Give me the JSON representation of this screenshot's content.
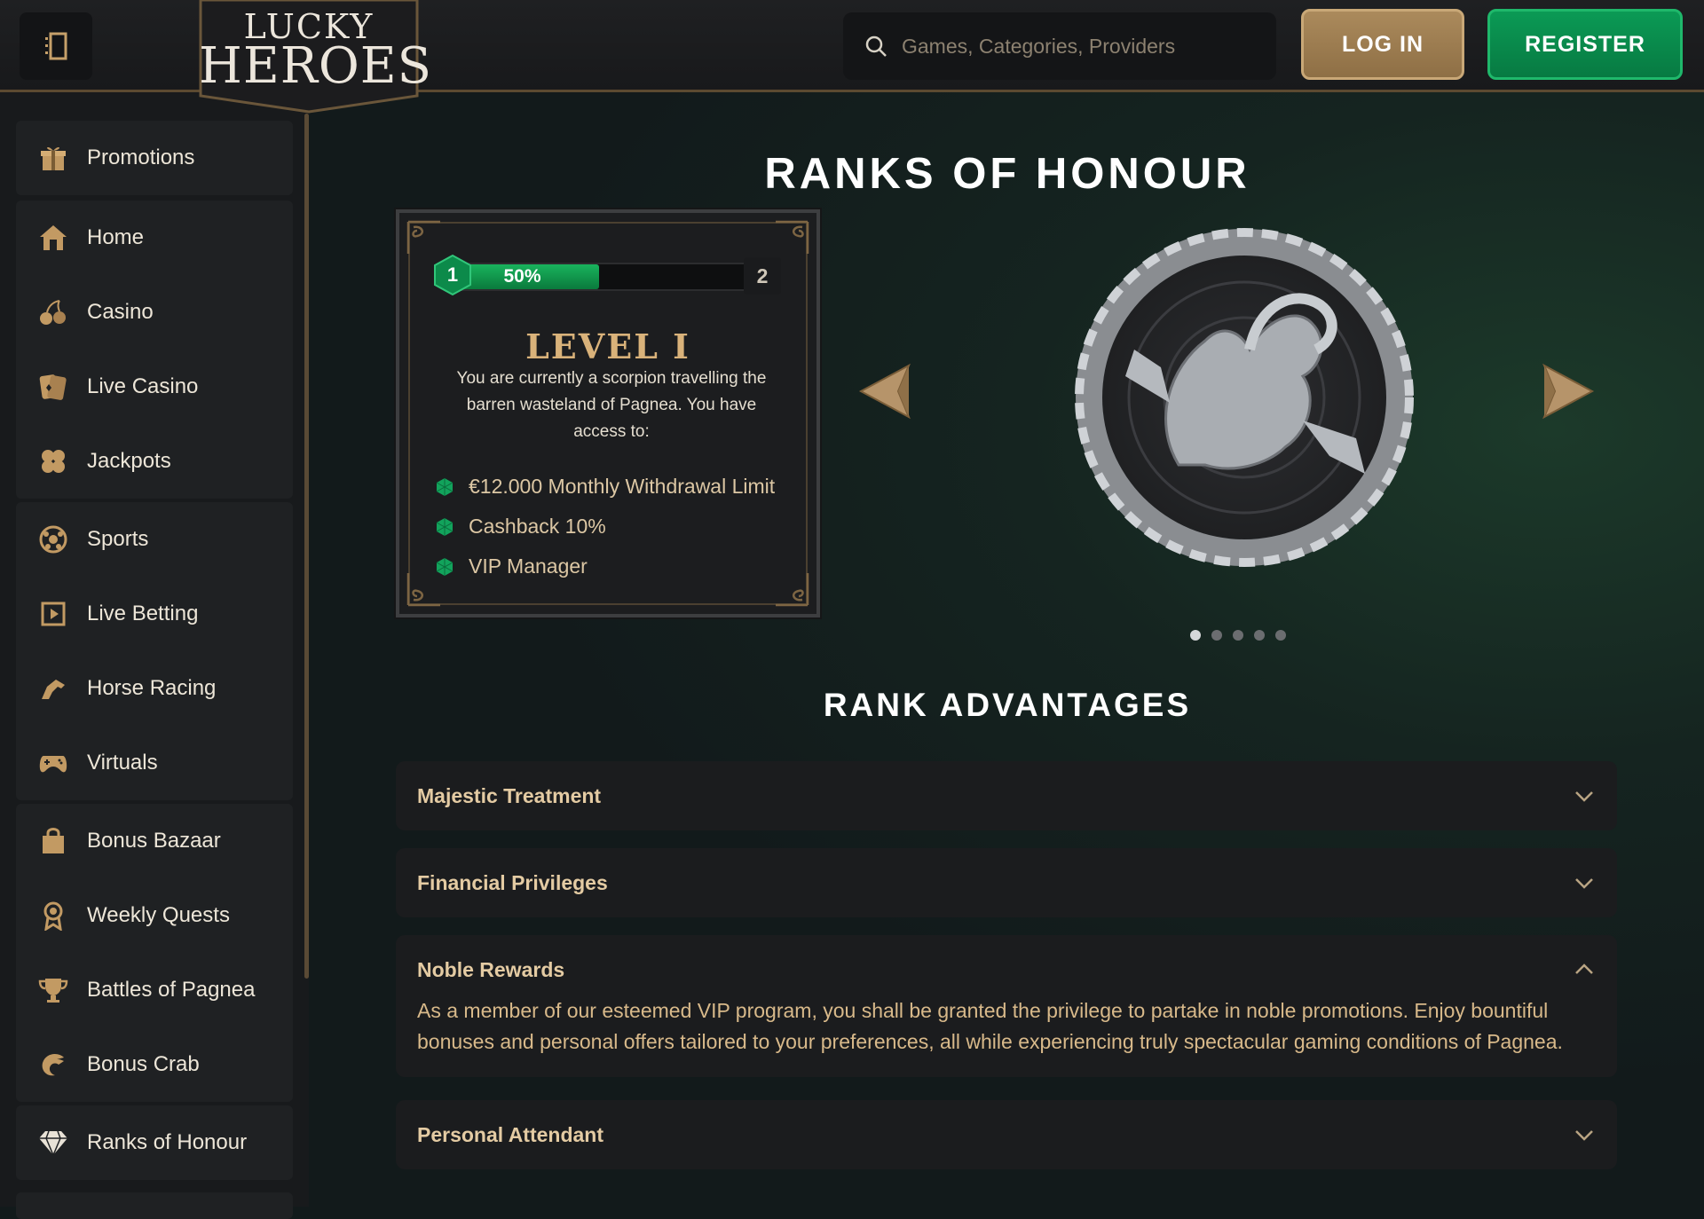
{
  "header": {
    "logo_line1": "LUCKY",
    "logo_line2": "HEROES",
    "search_placeholder": "Games, Categories, Providers",
    "login_label": "LOG IN",
    "register_label": "REGISTER"
  },
  "sidebar": {
    "groups": [
      [
        {
          "label": "Promotions",
          "icon": "gift-icon"
        }
      ],
      [
        {
          "label": "Home",
          "icon": "home-icon"
        },
        {
          "label": "Casino",
          "icon": "cherries-icon"
        },
        {
          "label": "Live Casino",
          "icon": "cards-icon"
        },
        {
          "label": "Jackpots",
          "icon": "clover-icon"
        }
      ],
      [
        {
          "label": "Sports",
          "icon": "football-icon"
        },
        {
          "label": "Live Betting",
          "icon": "live-play-icon"
        },
        {
          "label": "Horse Racing",
          "icon": "horse-icon"
        },
        {
          "label": "Virtuals",
          "icon": "gamepad-icon"
        }
      ],
      [
        {
          "label": "Bonus Bazaar",
          "icon": "shopping-bag-icon"
        },
        {
          "label": "Weekly Quests",
          "icon": "award-icon"
        },
        {
          "label": "Battles of Pagnea",
          "icon": "trophy-icon"
        },
        {
          "label": "Bonus Crab",
          "icon": "crab-claw-icon"
        }
      ],
      [
        {
          "label": "Ranks of Honour",
          "icon": "diamond-icon"
        }
      ]
    ]
  },
  "ranks": {
    "title": "RANKS OF HONOUR",
    "current_level": "1",
    "next_level": "2",
    "progress_percent": 50,
    "progress_label": "50%",
    "level_title": "LEVEL I",
    "description": "You are currently a scorpion travelling the barren wasteland of Pagnea. You have access to:",
    "perks": [
      "€12.000 Monthly Withdrawal Limit",
      "Cashback 10%",
      "VIP Manager"
    ],
    "carousel_count": 5,
    "carousel_active": 0
  },
  "advantages": {
    "title": "RANK ADVANTAGES",
    "items": [
      {
        "title": "Majestic Treatment",
        "expanded": false
      },
      {
        "title": "Financial Privileges",
        "expanded": false
      },
      {
        "title": "Noble Rewards",
        "expanded": true,
        "body": "As a member of our esteemed VIP program, you shall be granted the privilege to partake in noble promotions. Enjoy bountiful bonuses and personal offers tailored to your preferences, all while experiencing truly spectacular gaming conditions of Pagnea."
      },
      {
        "title": "Personal Attendant",
        "expanded": false
      }
    ]
  },
  "colors": {
    "gold": "#c29a63",
    "green": "#0b9a55",
    "background": "#121a1b"
  }
}
